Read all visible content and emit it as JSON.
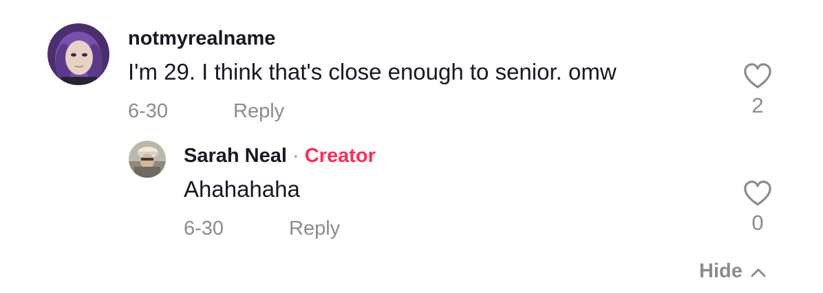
{
  "comments": [
    {
      "username": "notmyrealname",
      "text": "I'm 29. I think that's close enough to senior. omw",
      "date": "6-30",
      "reply_label": "Reply",
      "like_count": "2"
    }
  ],
  "reply": {
    "username": "Sarah Neal",
    "separator": "·",
    "badge": "Creator",
    "text": "Ahahahaha",
    "date": "6-30",
    "reply_label": "Reply",
    "like_count": "0"
  },
  "hide_label": "Hide",
  "colors": {
    "creator_badge": "#fe2c55",
    "muted": "#8a8b91",
    "text": "#161823"
  },
  "icons": {
    "like": "heart-outline-icon",
    "hide": "chevron-up-icon"
  }
}
